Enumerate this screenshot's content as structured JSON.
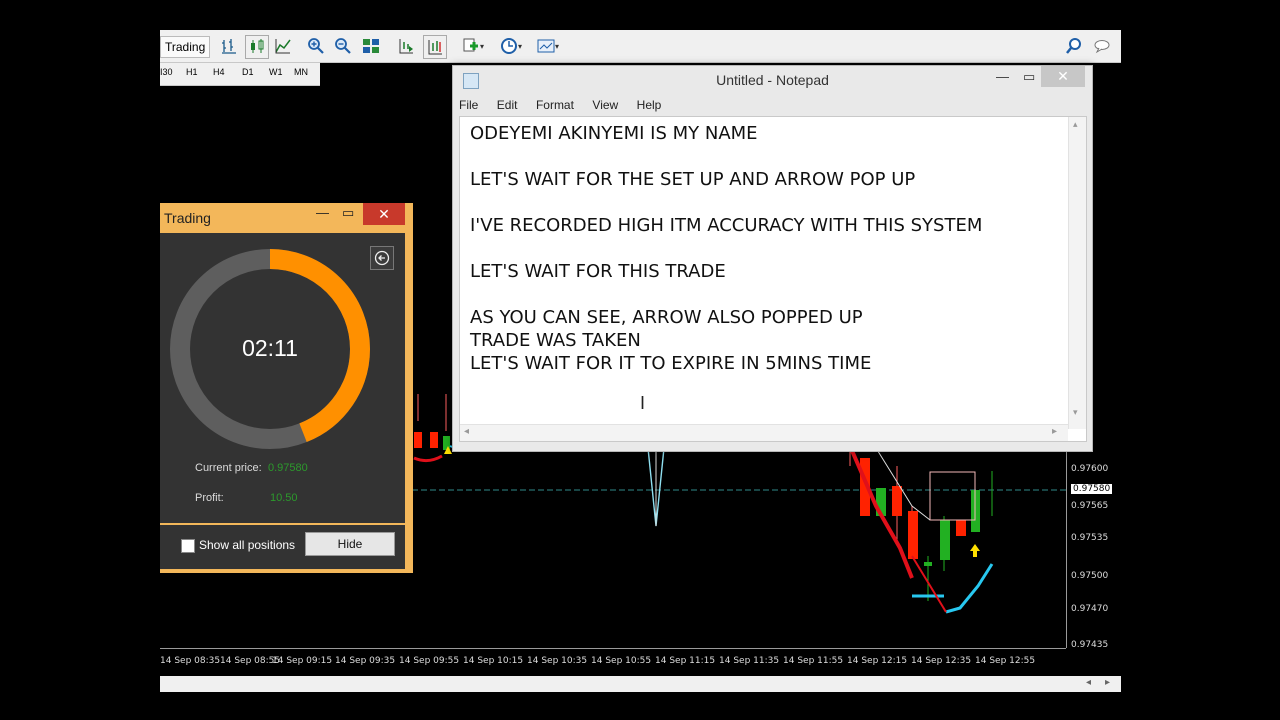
{
  "mt4": {
    "toolbar": {
      "trading_label": "Trading",
      "icons": [
        "bar-chart-icon",
        "candle-chart-icon",
        "line-chart-icon",
        "zoom-in-icon",
        "zoom-out-icon",
        "tile-windows-icon",
        "autoscroll-icon",
        "chart-shift-icon",
        "indicators-icon",
        "periods-icon",
        "templates-icon",
        "search-icon",
        "chat-icon"
      ]
    },
    "timeframes": [
      "I30",
      "H1",
      "H4",
      "D1",
      "W1",
      "MN"
    ],
    "price_levels": [
      "0.97600",
      "0.97580",
      "0.97565",
      "0.97535",
      "0.97500",
      "0.97470",
      "0.97435"
    ],
    "time_labels": [
      "14 Sep 08:35",
      "14 Sep 08:55",
      "14 Sep 09:15",
      "14 Sep 09:35",
      "14 Sep 09:55",
      "14 Sep 10:15",
      "14 Sep 10:35",
      "14 Sep 10:55",
      "14 Sep 11:15",
      "14 Sep 11:35",
      "14 Sep 11:55",
      "14 Sep 12:15",
      "14 Sep 12:35",
      "14 Sep 12:55"
    ],
    "colors": {
      "bull": "#22b022",
      "bear": "#ff2200",
      "ma_red": "#e0101a",
      "ma_cyan": "#28c8f0",
      "arrow": "#ffe000"
    }
  },
  "trading_window": {
    "title": "Trading",
    "timer": "02:11",
    "timer_progress": 0.44,
    "current_price_label": "Current price:",
    "current_price_value": "0.97580",
    "profit_label": "Profit:",
    "profit_value": "10.50",
    "show_all_label": "Show all positions",
    "hide_label": "Hide",
    "colors": {
      "frame": "#f3b75a",
      "ring_fg": "#ff9000",
      "ring_bg": "#5e5e5e",
      "close": "#c8392b"
    }
  },
  "notepad": {
    "title": "Untitled - Notepad",
    "menu": [
      "File",
      "Edit",
      "Format",
      "View",
      "Help"
    ],
    "text": "ODEYEMI AKINYEMI IS MY NAME\n\nLET'S WAIT FOR THE SET UP AND ARROW POP UP\n\nI'VE RECORDED HIGH ITM ACCURACY WITH THIS SYSTEM\n\nLET'S WAIT FOR THIS TRADE\n\nAS YOU CAN SEE, ARROW ALSO POPPED UP\nTRADE WAS TAKEN\nLET'S WAIT FOR IT TO EXPIRE IN 5MINS TIME"
  }
}
